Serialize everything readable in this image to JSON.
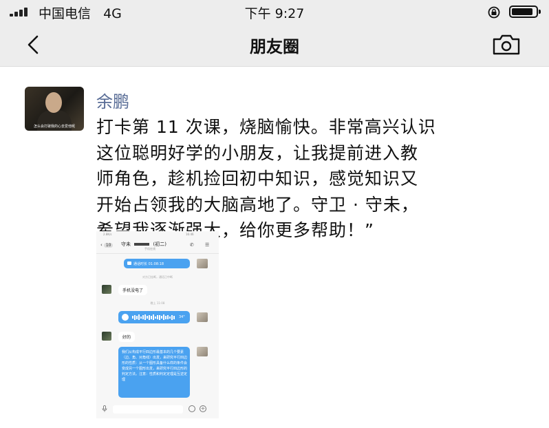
{
  "status_bar": {
    "carrier": "中国电信",
    "network": "4G",
    "time": "下午 9:27"
  },
  "nav": {
    "title": "朋友圈",
    "back_icon": "chevron-left-icon",
    "camera_icon": "camera-icon"
  },
  "post": {
    "author": "余鹏",
    "text_lines": [
      "打卡第 11 次课，烧脑愉快。非常高兴认识",
      "这位聪明好学的小朋友，让我提前进入教",
      "师角色，趁机捡回初中知识，感觉知识又",
      "开始占领我的大脑高地了。守卫 · 守未，",
      "希望我逐渐强大，给你更多帮助！”"
    ],
    "avatar_caption": "怎么会打破我的心去爱他呢"
  },
  "chat_screenshot": {
    "back_count": "10",
    "contact_title": "守未",
    "contact_tag": "(初二)",
    "contact_sub": "手机在线",
    "status_time": "16:46",
    "status_speed": "2.8K/s",
    "video_call_label": "通话时长 01:08:18",
    "sys_note_1": "对方已挂断，通话已中断",
    "msg_phone_dead": "手机没电了",
    "sys_time": "晚上 11:08",
    "voice_duration": "34\"",
    "msg_ok": "好的",
    "long_msg": "我们从构成平行四边形最基本的几个要素（边、角、对角线）出发，来研究平行四边形的性质：从一个图形具备什么样的条件会变成另一个图形出发，来研究平行四边形的判定方法。注意：性质和判定定理是互逆定理"
  },
  "colors": {
    "nav_bg": "#ededed",
    "author_link": "#576b95",
    "bubble_blue": "#4aa2f0"
  }
}
